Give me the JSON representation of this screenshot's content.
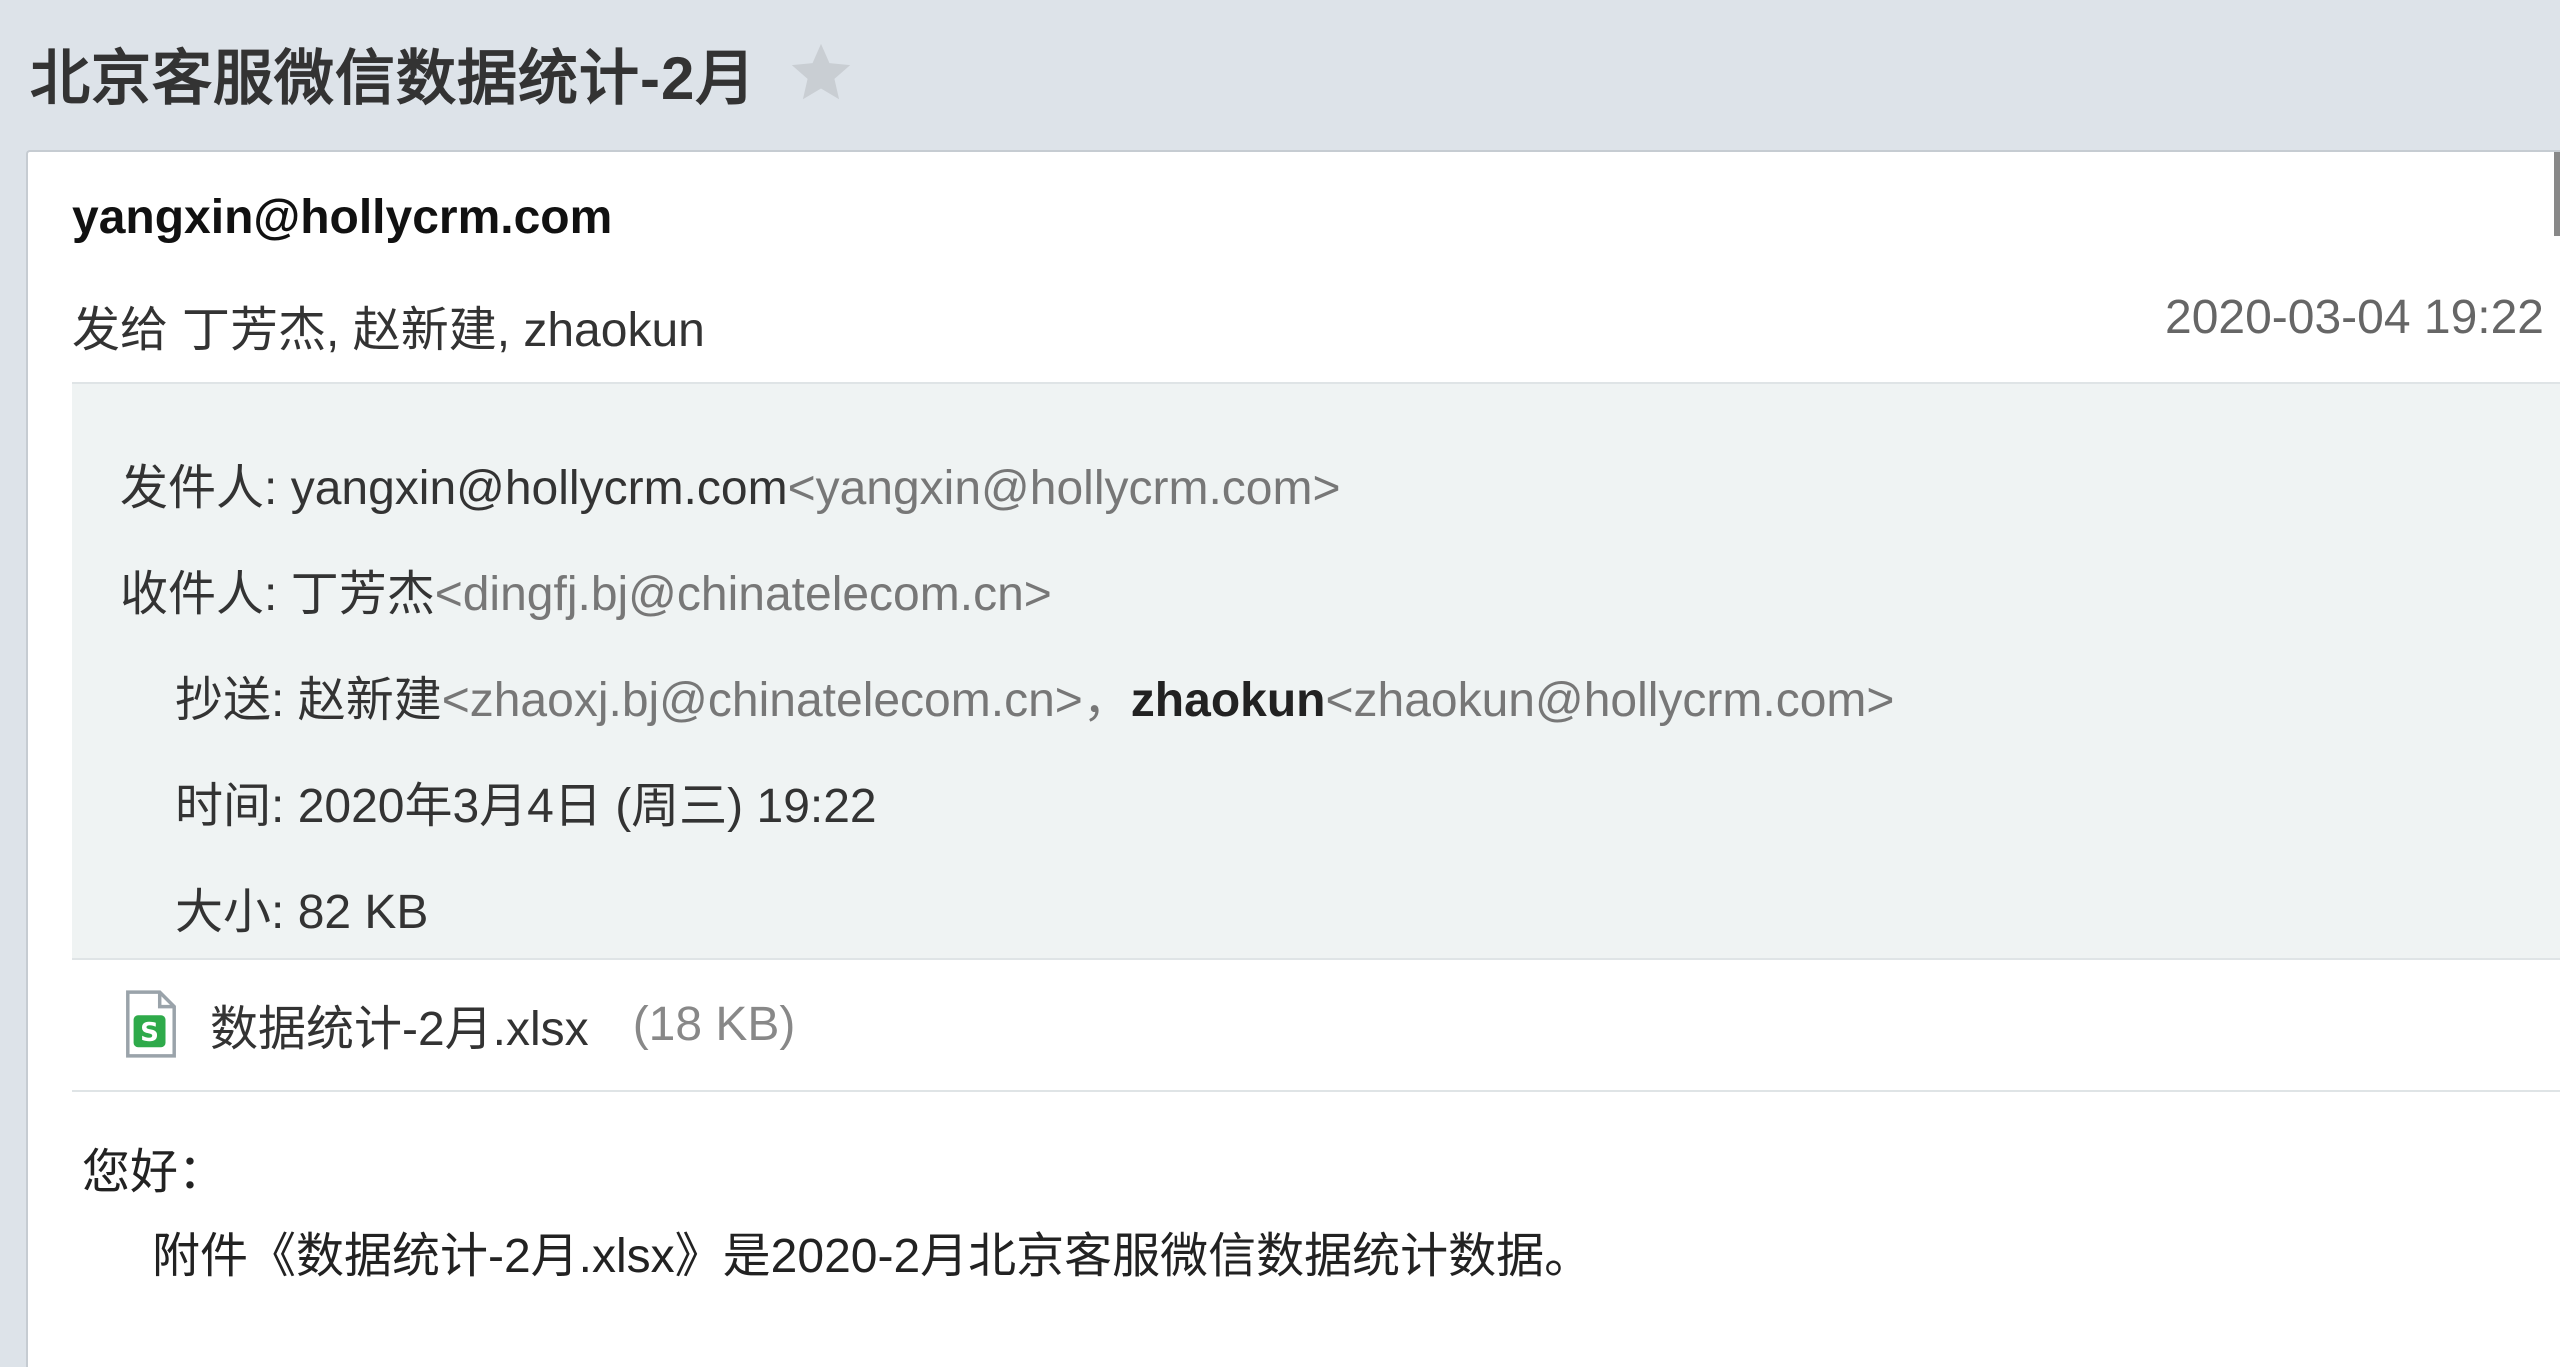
{
  "subject": {
    "title": "北京客服微信数据统计-2月",
    "star_icon": "star-outline-icon",
    "star_color": "#c9ced3"
  },
  "summary": {
    "sender": "yangxin@hollycrm.com",
    "to_prefix": "发给",
    "to_recipients": "丁芳杰, 赵新建, zhaokun",
    "date": "2020-03-04 19:22"
  },
  "details": {
    "from": {
      "label": "发件人:",
      "name": "yangxin@hollycrm.com",
      "address": "<yangxin@hollycrm.com>"
    },
    "to": {
      "label": "收件人:",
      "name": "丁芳杰",
      "address": "<dingfj.bj@chinatelecom.cn>"
    },
    "cc": {
      "label": "抄送:",
      "recipients": [
        {
          "name": "赵新建",
          "address": "<zhaoxj.bj@chinatelecom.cn>，"
        },
        {
          "name": "zhaokun",
          "address": "<zhaokun@hollycrm.com>"
        }
      ]
    },
    "time": {
      "label": "时间:",
      "value": "2020年3月4日 (周三) 19:22"
    },
    "size": {
      "label": "大小:",
      "value": "82 KB"
    }
  },
  "attachment": {
    "icon": "xlsx-file-icon",
    "icon_color": "#2eaa4a",
    "name": "数据统计-2月.xlsx",
    "size": "(18 KB)"
  },
  "body": {
    "greeting": "您好：",
    "line1": "附件《数据统计-2月.xlsx》是2020-2月北京客服微信数据统计数据。"
  }
}
